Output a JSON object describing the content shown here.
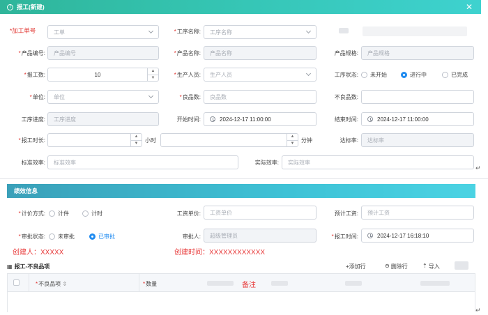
{
  "dialog": {
    "title": "报工(新建)",
    "info_icon": "info-circle-icon",
    "close_icon": "close-icon"
  },
  "form": {
    "work_order_no": {
      "label": "*加工单号",
      "placeholder": "工单"
    },
    "process_name": {
      "label": "工序名称:",
      "placeholder": "工序名称"
    },
    "product_code": {
      "label": "产品编号:",
      "placeholder": "产品编号"
    },
    "product_name": {
      "label": "产品名称:",
      "placeholder": "产品名称"
    },
    "product_spec": {
      "label": "产品规格:",
      "placeholder": "产品规格"
    },
    "report_qty": {
      "label": "报工数:",
      "value": "10"
    },
    "operator": {
      "label": "生产人员:",
      "placeholder": "生产人员"
    },
    "process_status": {
      "label": "工序状态:",
      "options": [
        "未开始",
        "进行中",
        "已完成"
      ],
      "selected": "进行中"
    },
    "unit": {
      "label": "单位:",
      "placeholder": "单位"
    },
    "good_qty": {
      "label": "良品数:",
      "placeholder": "良品数"
    },
    "defect_qty": {
      "label": "不良品数:"
    },
    "progress": {
      "label": "工序进度:",
      "placeholder": "工序进度"
    },
    "start_time": {
      "label": "开始时间:",
      "value": "2024-12-17 11:00:00"
    },
    "end_time": {
      "label": "结束时间:",
      "value": "2024-12-17 11:00:00"
    },
    "duration": {
      "label": "报工时长:",
      "hour_unit": "小时",
      "minute_unit": "分钟"
    },
    "rate": {
      "label": "达标率:",
      "placeholder": "达标率"
    },
    "std_eff": {
      "label": "标准效率:",
      "placeholder": "标准效率"
    },
    "actual_eff": {
      "label": "实际效率:",
      "placeholder": "实际效率"
    }
  },
  "performance": {
    "title": "绩效信息",
    "pricing_method": {
      "label": "计价方式:",
      "options": [
        "计件",
        "计时"
      ]
    },
    "unit_price": {
      "label": "工资单价:",
      "placeholder": "工资单价"
    },
    "est_wage": {
      "label": "预计工资:",
      "placeholder": "预计工资"
    },
    "approval_status": {
      "label": "审批状态:",
      "options": [
        "未审批",
        "已审批"
      ],
      "selected": "已审批"
    },
    "approver": {
      "label": "审批人:",
      "placeholder": "超级管理员"
    },
    "report_time": {
      "label": "报工时间:",
      "value": "2024-12-17 16:18:10"
    },
    "creator_note": "创建人：XXXXX",
    "created_note": "创建时间：XXXXXXXXXXXX"
  },
  "defects": {
    "title": "报工-不良品项",
    "add_row": "+添加行",
    "delete_row": "删除行",
    "import": "导入",
    "columns": [
      "不良品项",
      "数量"
    ],
    "remark_note": "备注"
  },
  "colors": {
    "header": "#34c3b0",
    "primary": "#1f8bf0",
    "required": "#e0312c",
    "annotation": "#e83a3a"
  }
}
